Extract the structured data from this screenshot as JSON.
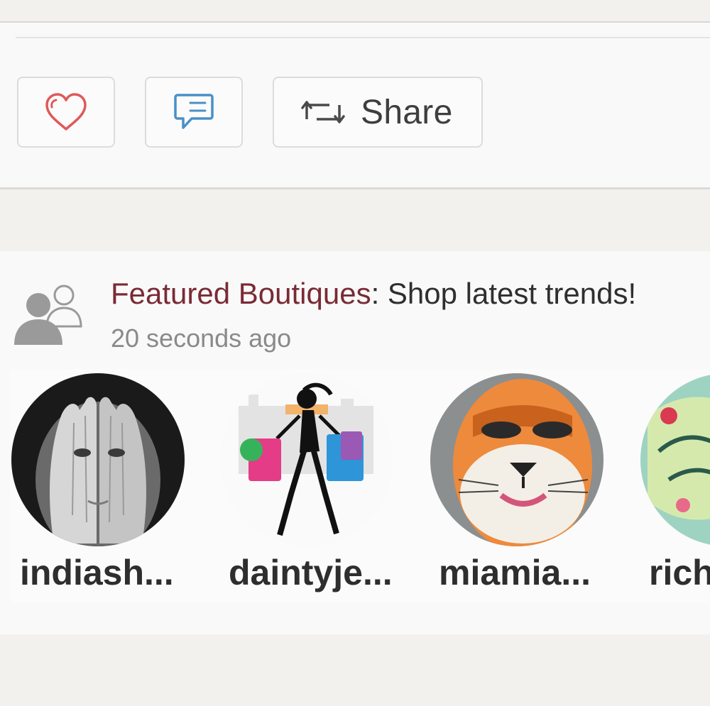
{
  "actions": {
    "like_icon": "heart-icon",
    "comment_icon": "comment-icon",
    "share_icon": "repost-icon",
    "share_label": "Share"
  },
  "feed": {
    "title_brand": "Featured Boutiques",
    "title_separator": ":",
    "title_text": " Shop latest trends!",
    "timestamp": "20 seconds ago",
    "shops": [
      {
        "handle": "indiash..."
      },
      {
        "handle": "daintyje..."
      },
      {
        "handle": "miamia..."
      },
      {
        "handle": "rich"
      }
    ]
  },
  "colors": {
    "heart": "#e0585a",
    "comment": "#4a90c8",
    "brand_title": "#7a2a35",
    "muted": "#8a8a8a"
  }
}
